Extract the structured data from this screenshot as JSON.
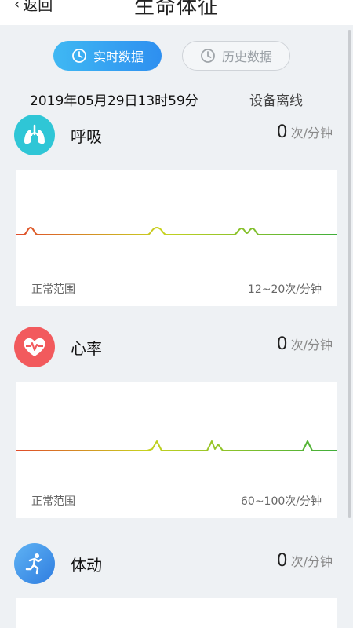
{
  "header": {
    "back_label": "返回",
    "title": "生命体征"
  },
  "tabs": [
    {
      "label": "实时数据",
      "icon": "clock-icon",
      "active": true
    },
    {
      "label": "历史数据",
      "icon": "clock-icon",
      "active": false
    }
  ],
  "info": {
    "datetime": "2019年05月29日13时59分",
    "device_status": "设备离线"
  },
  "sections": [
    {
      "title": "呼吸",
      "icon": "lungs-icon",
      "value": "0",
      "unit": "次/分钟",
      "range_label": "正常范围",
      "range": "12~20次/分钟",
      "color": "#2fc6d6"
    },
    {
      "title": "心率",
      "icon": "heart-pulse-icon",
      "value": "0",
      "unit": "次/分钟",
      "range_label": "正常范围",
      "range": "60~100次/分钟",
      "color": "#f25a5d"
    },
    {
      "title": "体动",
      "icon": "running-person-icon",
      "value": "0",
      "unit": "次/分钟",
      "color": "#3d97ea"
    }
  ],
  "colors": {
    "accent_blue": "#2e8ff0",
    "line_start": "#e04a2a",
    "line_mid": "#c8d21f",
    "line_end": "#3fae3a"
  }
}
